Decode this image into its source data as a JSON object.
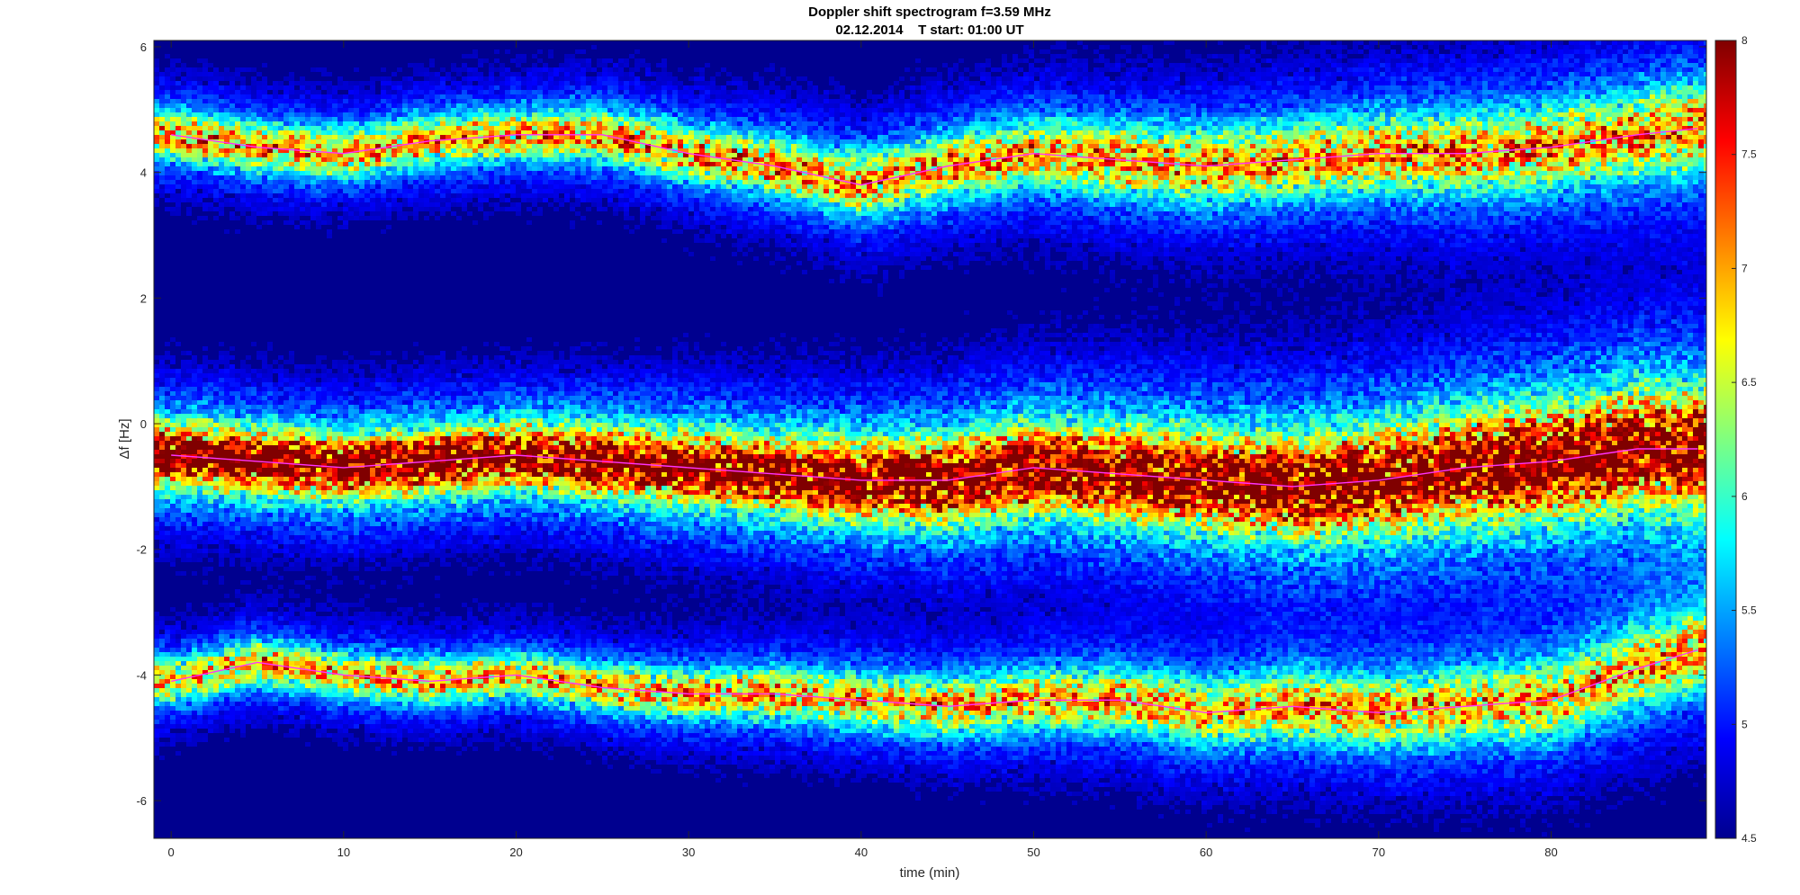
{
  "chart_data": {
    "type": "heatmap",
    "title": "Doppler shift spectrogram f=3.59 MHz",
    "subtitle": "02.12.2014    T start: 01:00 UT",
    "xlabel": "time (min)",
    "ylabel": "Δf [Hz]",
    "xlim": [
      -1,
      89
    ],
    "ylim": [
      -6.6,
      6.1
    ],
    "x_ticks": [
      0,
      10,
      20,
      30,
      40,
      50,
      60,
      70,
      80
    ],
    "x_tick_labels": [
      "0",
      "10",
      "20",
      "30",
      "40",
      "50",
      "60",
      "70",
      "80"
    ],
    "y_ticks": [
      -6,
      -4,
      -2,
      0,
      2,
      4,
      6
    ],
    "y_tick_labels": [
      "-6",
      "-4",
      "-2",
      "0",
      "2",
      "4",
      "6"
    ],
    "colorbar": {
      "clim": [
        4.5,
        8
      ],
      "ticks": [
        4.5,
        5,
        5.5,
        6,
        6.5,
        7,
        7.5,
        8
      ],
      "tick_labels": [
        "4.5",
        "5",
        "5.5",
        "6",
        "6.5",
        "7",
        "7.5",
        "8"
      ],
      "colormap": "jet"
    },
    "background_color": "#00008f",
    "trace_color": "#ff33ff",
    "peak_color": "#000000",
    "series": [
      {
        "role": "upper echo band",
        "x": [
          0,
          5,
          10,
          15,
          20,
          25,
          30,
          35,
          40,
          45,
          50,
          55,
          60,
          65,
          70,
          75,
          80,
          85,
          88.5
        ],
        "y": [
          4.6,
          4.4,
          4.3,
          4.5,
          4.6,
          4.6,
          4.3,
          4.1,
          3.8,
          4.1,
          4.3,
          4.2,
          4.1,
          4.2,
          4.3,
          4.3,
          4.4,
          4.6,
          4.7
        ]
      },
      {
        "role": "central echo band",
        "x": [
          0,
          5,
          10,
          15,
          20,
          25,
          30,
          35,
          40,
          45,
          50,
          55,
          60,
          65,
          70,
          75,
          80,
          85,
          88.5
        ],
        "y": [
          -0.5,
          -0.6,
          -0.7,
          -0.6,
          -0.5,
          -0.6,
          -0.7,
          -0.8,
          -0.9,
          -0.9,
          -0.7,
          -0.8,
          -0.9,
          -1.0,
          -0.9,
          -0.7,
          -0.6,
          -0.4,
          -0.4
        ]
      },
      {
        "role": "lower echo band",
        "x": [
          0,
          5,
          10,
          15,
          20,
          25,
          30,
          35,
          40,
          45,
          50,
          55,
          60,
          65,
          70,
          75,
          80,
          85,
          88.5
        ],
        "y": [
          -4.1,
          -3.8,
          -4.0,
          -4.1,
          -4.0,
          -4.2,
          -4.3,
          -4.3,
          -4.4,
          -4.5,
          -4.4,
          -4.4,
          -4.6,
          -4.5,
          -4.6,
          -4.5,
          -4.4,
          -3.9,
          -3.6
        ]
      }
    ]
  }
}
